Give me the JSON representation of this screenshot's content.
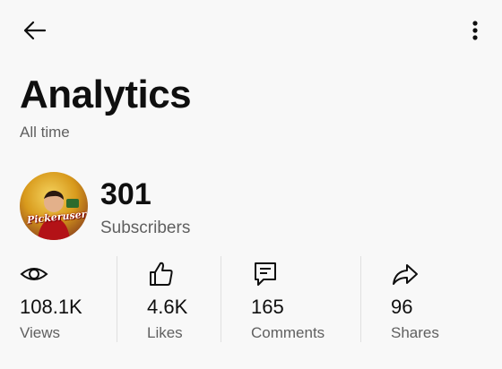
{
  "header": {
    "back_icon": "arrow-left-icon",
    "more_icon": "more-vertical-icon"
  },
  "page": {
    "title": "Analytics",
    "period": "All time"
  },
  "channel": {
    "avatar_text": "Pickeruser",
    "subscribers_value": "301",
    "subscribers_label": "Subscribers"
  },
  "stats": [
    {
      "icon": "eye-icon",
      "value": "108.1K",
      "label": "Views"
    },
    {
      "icon": "thumbs-up-icon",
      "value": "4.6K",
      "label": "Likes"
    },
    {
      "icon": "comment-icon",
      "value": "165",
      "label": "Comments"
    },
    {
      "icon": "share-icon",
      "value": "96",
      "label": "Shares"
    }
  ]
}
